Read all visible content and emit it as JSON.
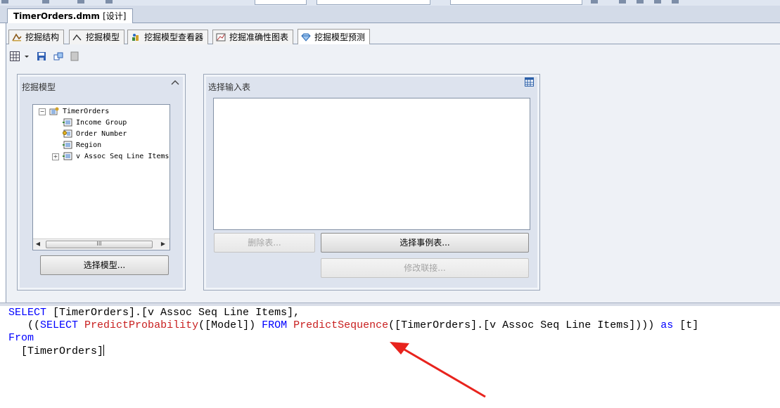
{
  "document_tab": {
    "name": "TimerOrders.dmm",
    "suffix": "[设计]"
  },
  "designer_tabs": [
    {
      "label": "挖掘结构",
      "icon": "structure-icon"
    },
    {
      "label": "挖掘模型",
      "icon": "model-icon"
    },
    {
      "label": "挖掘模型查看器",
      "icon": "viewer-icon"
    },
    {
      "label": "挖掘准确性图表",
      "icon": "chart-icon"
    },
    {
      "label": "挖掘模型预测",
      "icon": "diamond-icon",
      "active": true
    }
  ],
  "mining_model_panel": {
    "title": "挖掘模型",
    "tree": {
      "root": "TimerOrders",
      "columns": [
        "Income Group",
        "Order Number",
        "Region",
        "v Assoc Seq Line Items"
      ]
    },
    "scroll_thumb": "III",
    "select_button": "选择模型..."
  },
  "input_table_panel": {
    "title": "选择输入表",
    "remove_button": "删除表...",
    "select_case_button": "选择事例表...",
    "modify_join_button": "修改联接..."
  },
  "query": {
    "line1": {
      "kw": "SELECT",
      "rest": " [TimerOrders].[v Assoc Seq Line Items],"
    },
    "line2": {
      "pre": "   ((",
      "kw1": "SELECT",
      "sp1": " ",
      "fn1": "PredictProbability",
      "mid1": "([Model]) ",
      "kw2": "FROM",
      "sp2": " ",
      "fn2": "PredictSequence",
      "mid2": "([TimerOrders].[v Assoc Seq Line Items]))) ",
      "kw3": "as",
      "end": " [t]"
    },
    "line3": {
      "kw": "From"
    },
    "line4": {
      "text": "  [TimerOrders]"
    }
  },
  "colors": {
    "keyword": "#0000ff",
    "function": "#c81e1e",
    "arrow": "#e8231d"
  }
}
